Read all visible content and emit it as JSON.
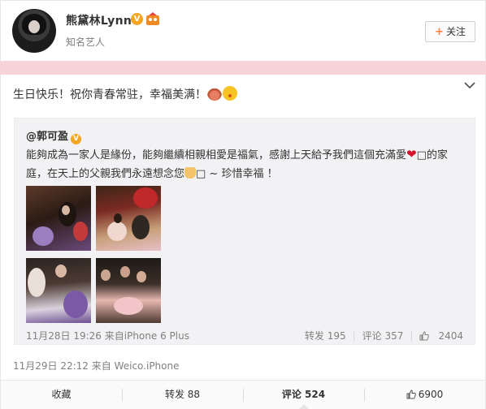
{
  "header": {
    "username": "熊黛林Lynn",
    "verified_badge": "V",
    "description": "知名艺人",
    "follow_label": "关注",
    "follow_icon": "+"
  },
  "post": {
    "text": "生日快乐！祝你青春常驻，幸福美满！",
    "emojis": [
      "cake-emoji",
      "kiss-emoji"
    ],
    "meta": "11月29日 22:12 来自 Weico.iPhone"
  },
  "repost": {
    "author": "@郭可盈",
    "verified_badge": "V",
    "text_part1": "能夠成為一家人是緣份，能夠繼續相親相愛是福氣，感謝上天給予我們這個充滿愛",
    "text_part2": "□的家庭，在天上的父親我們永遠想念您",
    "text_part3": "□ ~ 珍惜幸福 ！",
    "meta": "11月28日 19:26 来自iPhone 6 Plus",
    "reposts": "转发 195",
    "comments": "评论 357",
    "likes": "2404"
  },
  "actions": {
    "favorite": "收藏",
    "repost": "转发 88",
    "comment": "评论 524",
    "like": "6900"
  },
  "colors": {
    "accent_pink_band": "#f7d4da",
    "follow_plus": "#ff8140",
    "verified": "#f5a623",
    "heart": "#d5142b"
  }
}
